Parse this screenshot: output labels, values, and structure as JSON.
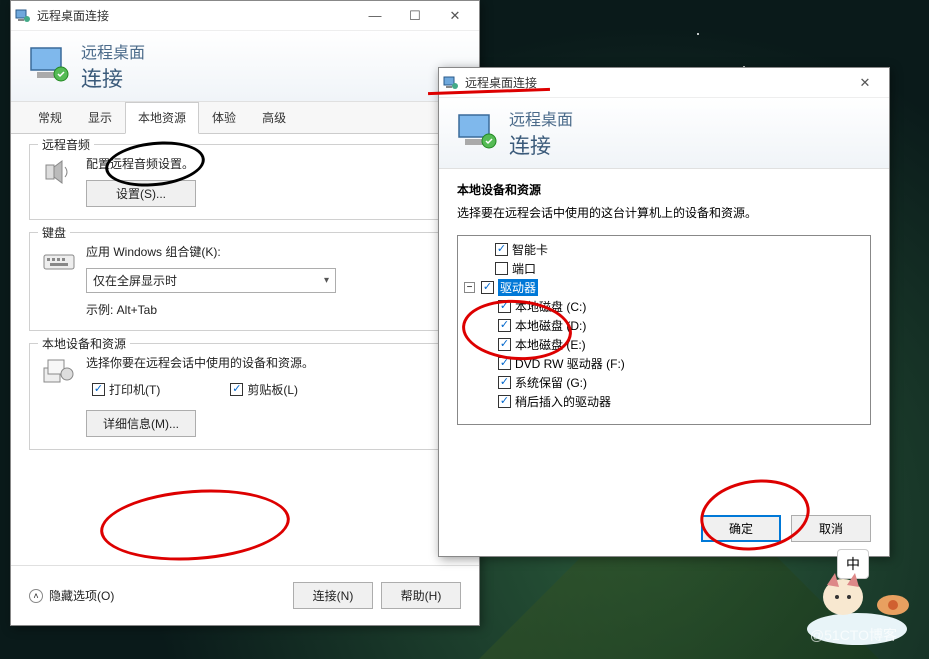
{
  "window1": {
    "title": "远程桌面连接",
    "header_line1": "远程桌面",
    "header_line2": "连接",
    "tabs": [
      "常规",
      "显示",
      "本地资源",
      "体验",
      "高级"
    ],
    "active_tab_index": 2,
    "audio": {
      "group": "远程音频",
      "desc": "配置远程音频设置。",
      "btn": "设置(S)..."
    },
    "keyboard": {
      "group": "键盘",
      "desc": "应用 Windows 组合键(K):",
      "select_value": "仅在全屏显示时",
      "example": "示例: Alt+Tab"
    },
    "devices": {
      "group": "本地设备和资源",
      "desc": "选择你要在远程会话中使用的设备和资源。",
      "printer": "打印机(T)",
      "clipboard": "剪贴板(L)",
      "details_btn": "详细信息(M)..."
    },
    "hide_options": "隐藏选项(O)",
    "connect_btn": "连接(N)",
    "help_btn": "帮助(H)"
  },
  "window2": {
    "title": "远程桌面连接",
    "header_line1": "远程桌面",
    "header_line2": "连接",
    "heading": "本地设备和资源",
    "desc": "选择要在远程会话中使用的这台计算机上的设备和资源。",
    "tree": {
      "smartcard": "智能卡",
      "port": "端口",
      "drives": "驱动器",
      "drive_items": [
        "本地磁盘 (C:)",
        "本地磁盘 (D:)",
        "本地磁盘 (E:)",
        "DVD RW 驱动器 (F:)",
        "系统保留 (G:)",
        "稍后插入的驱动器"
      ]
    },
    "ok_btn": "确定",
    "cancel_btn": "取消"
  },
  "ime": "中",
  "watermark": "@51CTO博客"
}
